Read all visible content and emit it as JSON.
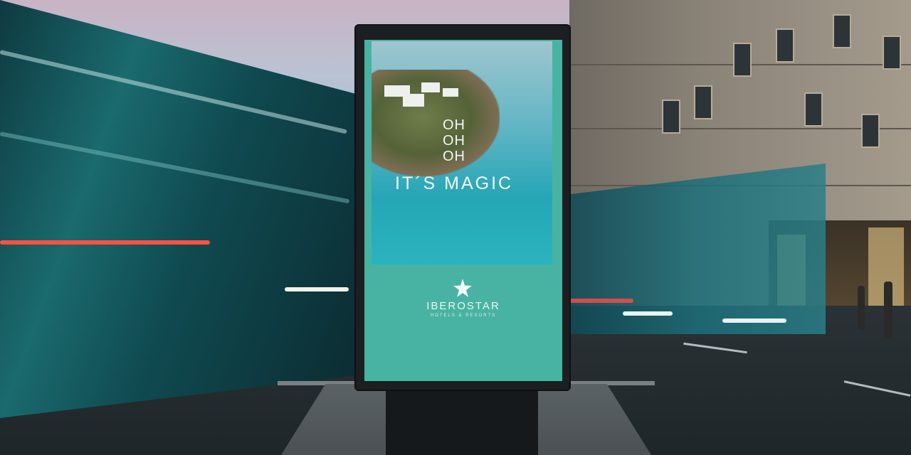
{
  "poster": {
    "headline_line1": "OH",
    "headline_line2": "OH",
    "headline_line3": "OH",
    "tagline": "IT´S MAGIC",
    "brand_name": "IBEROSTAR",
    "brand_subtitle": "HOTELS & RESORTS"
  },
  "colors": {
    "poster_teal": "#48b3a2",
    "sea": "#25a6b6",
    "frame": "#1b1f21"
  },
  "icons": {
    "brand_mark": "star-icon"
  }
}
